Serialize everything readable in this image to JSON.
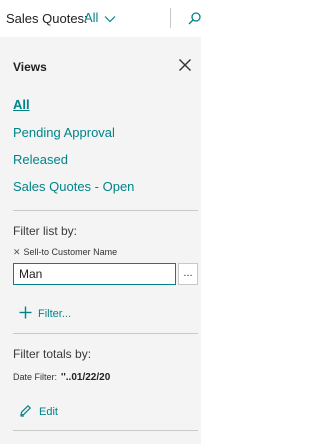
{
  "header": {
    "title": "Sales Quotes:",
    "view_selector": "All",
    "icons": [
      "chevron-down-icon",
      "search-icon"
    ]
  },
  "panel": {
    "title": "Views",
    "views": [
      {
        "label": "All",
        "active": true
      },
      {
        "label": "Pending Approval",
        "active": false
      },
      {
        "label": "Released",
        "active": false
      },
      {
        "label": "Sales Quotes - Open",
        "active": false
      }
    ],
    "filter_list": {
      "title": "Filter list by:",
      "field_label": "Sell-to Customer Name",
      "field_value": "Man",
      "lookup_label": "...",
      "add_filter_label": "Filter..."
    },
    "filter_totals": {
      "title": "Filter totals by:",
      "date_filter_label": "Date Filter:",
      "date_filter_value": "''..01/22/20",
      "edit_label": "Edit"
    }
  },
  "colors": {
    "accent": "#008489",
    "panel_background": "#f4f4f4",
    "text": "#212121"
  }
}
